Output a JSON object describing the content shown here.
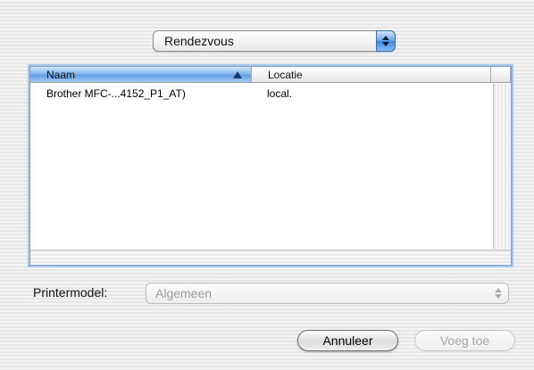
{
  "browser_popup": {
    "selected": "Rendezvous"
  },
  "printer_list": {
    "columns": [
      {
        "label": "Naam",
        "sorted": true,
        "sort_direction": "ascending"
      },
      {
        "label": "Locatie",
        "sorted": false
      }
    ],
    "rows": [
      {
        "name": "Brother MFC-...4152_P1_AT)",
        "location": "local."
      }
    ]
  },
  "printer_model": {
    "label": "Printermodel:",
    "value": "Algemeen",
    "enabled": false
  },
  "buttons": {
    "cancel": "Annuleer",
    "add": "Voeg toe",
    "add_enabled": false
  },
  "colors": {
    "accent": "#5d9be3",
    "list_border": "#7d9ec8",
    "disabled_text": "#a5a5a5"
  }
}
